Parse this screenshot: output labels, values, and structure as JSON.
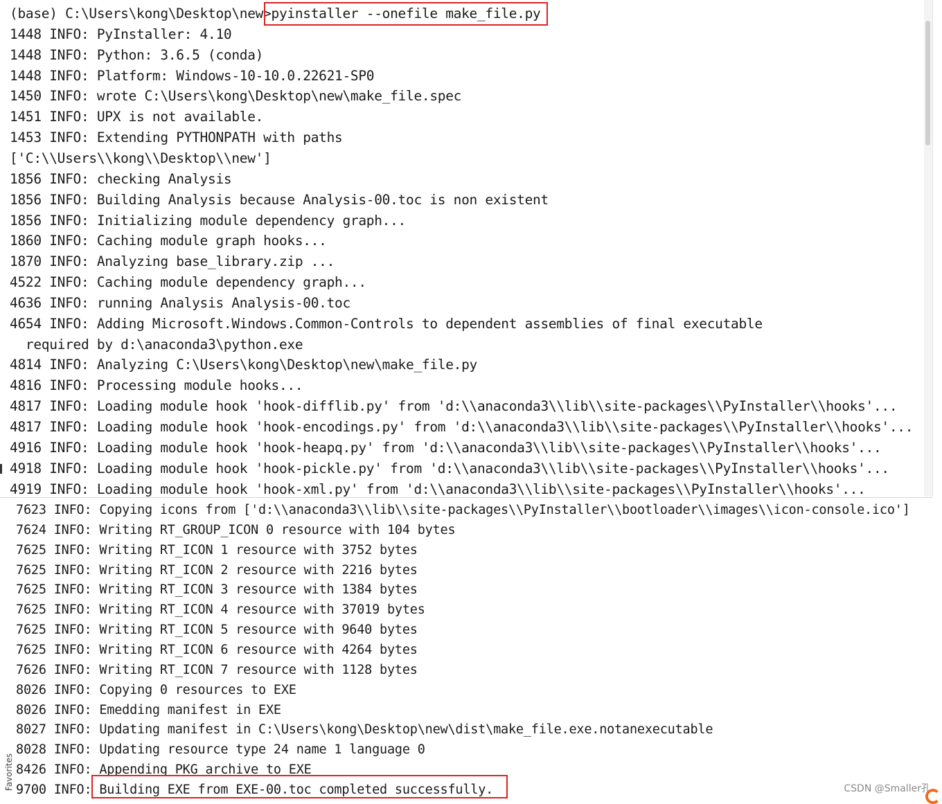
{
  "top_log": {
    "lines": [
      "(base) C:\\Users\\kong\\Desktop\\new>pyinstaller --onefile make_file.py",
      "1448 INFO: PyInstaller: 4.10",
      "1448 INFO: Python: 3.6.5 (conda)",
      "1448 INFO: Platform: Windows-10-10.0.22621-SP0",
      "1450 INFO: wrote C:\\Users\\kong\\Desktop\\new\\make_file.spec",
      "1451 INFO: UPX is not available.",
      "1453 INFO: Extending PYTHONPATH with paths",
      "['C:\\\\Users\\\\kong\\\\Desktop\\\\new']",
      "1856 INFO: checking Analysis",
      "1856 INFO: Building Analysis because Analysis-00.toc is non existent",
      "1856 INFO: Initializing module dependency graph...",
      "1860 INFO: Caching module graph hooks...",
      "1870 INFO: Analyzing base_library.zip ...",
      "4522 INFO: Caching module dependency graph...",
      "4636 INFO: running Analysis Analysis-00.toc",
      "4654 INFO: Adding Microsoft.Windows.Common-Controls to dependent assemblies of final executable",
      "  required by d:\\anaconda3\\python.exe",
      "4814 INFO: Analyzing C:\\Users\\kong\\Desktop\\new\\make_file.py",
      "4816 INFO: Processing module hooks...",
      "4817 INFO: Loading module hook 'hook-difflib.py' from 'd:\\\\anaconda3\\\\lib\\\\site-packages\\\\PyInstaller\\\\hooks'...",
      "4817 INFO: Loading module hook 'hook-encodings.py' from 'd:\\\\anaconda3\\\\lib\\\\site-packages\\\\PyInstaller\\\\hooks'...",
      "4916 INFO: Loading module hook 'hook-heapq.py' from 'd:\\\\anaconda3\\\\lib\\\\site-packages\\\\PyInstaller\\\\hooks'...",
      "4918 INFO: Loading module hook 'hook-pickle.py' from 'd:\\\\anaconda3\\\\lib\\\\site-packages\\\\PyInstaller\\\\hooks'...",
      "4919 INFO: Loading module hook 'hook-xml.py' from 'd:\\\\anaconda3\\\\lib\\\\site-packages\\\\PyInstaller\\\\hooks'..."
    ]
  },
  "bottom_log": {
    "lines": [
      "7623 INFO: Copying icons from ['d:\\\\anaconda3\\\\lib\\\\site-packages\\\\PyInstaller\\\\bootloader\\\\images\\\\icon-console.ico']",
      "7624 INFO: Writing RT_GROUP_ICON 0 resource with 104 bytes",
      "7625 INFO: Writing RT_ICON 1 resource with 3752 bytes",
      "7625 INFO: Writing RT_ICON 2 resource with 2216 bytes",
      "7625 INFO: Writing RT_ICON 3 resource with 1384 bytes",
      "7625 INFO: Writing RT_ICON 4 resource with 37019 bytes",
      "7625 INFO: Writing RT_ICON 5 resource with 9640 bytes",
      "7625 INFO: Writing RT_ICON 6 resource with 4264 bytes",
      "7626 INFO: Writing RT_ICON 7 resource with 1128 bytes",
      "8026 INFO: Copying 0 resources to EXE",
      "8026 INFO: Emedding manifest in EXE",
      "8027 INFO: Updating manifest in C:\\Users\\kong\\Desktop\\new\\dist\\make_file.exe.notanexecutable",
      "8028 INFO: Updating resource type 24 name 1 language 0",
      "8426 INFO: Appending PKG archive to EXE",
      "9700 INFO: Building EXE from EXE-00.toc completed successfully."
    ]
  },
  "sidebar": {
    "favorites_label": "Favorites"
  },
  "watermark": "CSDN @Smaller孔"
}
